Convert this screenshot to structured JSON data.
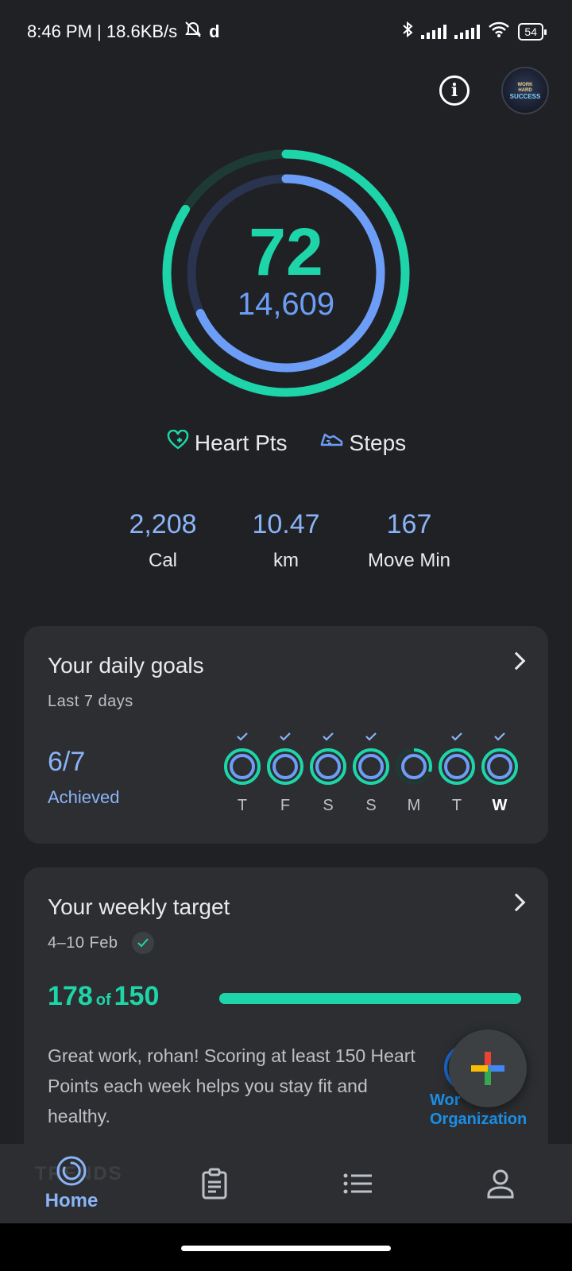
{
  "status_bar": {
    "time_speed": "8:46 PM | 18.6KB/s",
    "battery": "54",
    "icons": [
      "mute-icon",
      "app-icon",
      "bluetooth-icon",
      "signal-icon",
      "signal-icon",
      "wifi-icon",
      "battery-icon"
    ]
  },
  "header": {
    "info_icon": "info-icon",
    "avatar_text": [
      "WORK",
      "HARD",
      "SUCCESS"
    ]
  },
  "rings": {
    "heart_points": "72",
    "steps": "14,609",
    "heart_ring_progress": 0.84,
    "steps_ring_progress": 0.68,
    "colors": {
      "heart": "#1ed5a9",
      "steps": "#6c9ef8"
    }
  },
  "legend": {
    "heart_label": "Heart Pts",
    "steps_label": "Steps"
  },
  "stats": [
    {
      "value": "2,208",
      "label": "Cal"
    },
    {
      "value": "10.47",
      "label": "km"
    },
    {
      "value": "167",
      "label": "Move Min"
    }
  ],
  "daily_goals": {
    "title": "Your daily goals",
    "subtitle": "Last 7 days",
    "fraction": "6/7",
    "achieved_label": "Achieved",
    "days": [
      {
        "label": "T",
        "achieved": true,
        "progress": 1.0
      },
      {
        "label": "F",
        "achieved": true,
        "progress": 1.0
      },
      {
        "label": "S",
        "achieved": true,
        "progress": 1.0
      },
      {
        "label": "S",
        "achieved": true,
        "progress": 1.0
      },
      {
        "label": "M",
        "achieved": false,
        "progress": 0.3
      },
      {
        "label": "T",
        "achieved": true,
        "progress": 1.0
      },
      {
        "label": "W",
        "achieved": true,
        "progress": 1.0
      }
    ]
  },
  "weekly_target": {
    "title": "Your weekly target",
    "date_range": "4–10 Feb",
    "current": "178",
    "of_label": "of",
    "target": "150",
    "progress": 1.0,
    "description": "Great work, rohan! Scoring at least 150 Heart Points each week helps you stay fit and healthy.",
    "logo_line1": "Wor",
    "logo_line2": "Organization"
  },
  "fab": {
    "icon": "plus-icon"
  },
  "bottom_nav": {
    "ghost_text": "TRENDS",
    "items": [
      {
        "label": "Home",
        "icon": "home-rings-icon",
        "active": true
      },
      {
        "label": "",
        "icon": "journal-icon",
        "active": false
      },
      {
        "label": "",
        "icon": "list-icon",
        "active": false
      },
      {
        "label": "",
        "icon": "profile-icon",
        "active": false
      }
    ]
  }
}
